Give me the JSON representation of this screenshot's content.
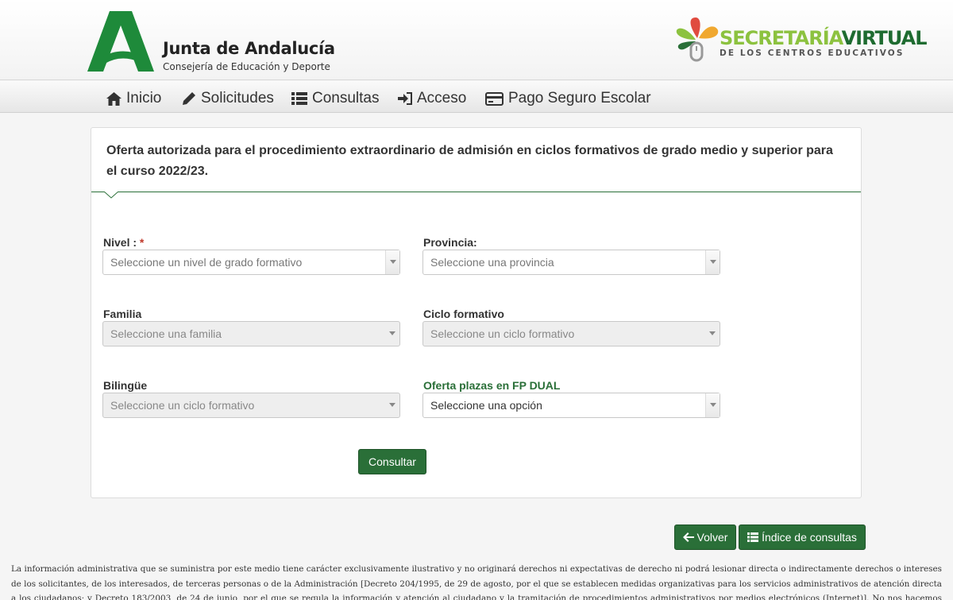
{
  "header": {
    "org_name": "Junta de Andalucía",
    "org_sub": "Consejería de Educación y Deporte",
    "sv_title_a": "SECRETARÍA",
    "sv_title_b": "VIRTUAL",
    "sv_sub": "DE LOS CENTROS EDUCATIVOS"
  },
  "nav": [
    {
      "label": "Inicio",
      "icon": "home-icon"
    },
    {
      "label": "Solicitudes",
      "icon": "pencil-icon"
    },
    {
      "label": "Consultas",
      "icon": "list-icon"
    },
    {
      "label": "Acceso",
      "icon": "sign-in-icon"
    },
    {
      "label": "Pago Seguro Escolar",
      "icon": "credit-card-icon"
    }
  ],
  "panel": {
    "title": "Oferta autorizada para el procedimiento extraordinario de admisión en ciclos formativos de grado medio y superior para el curso 2022/23."
  },
  "form": {
    "nivel": {
      "label": "Nivel :",
      "required_mark": "*",
      "placeholder": "Seleccione un nivel de grado formativo"
    },
    "provincia": {
      "label": "Provincia:",
      "placeholder": "Seleccione una provincia"
    },
    "familia": {
      "label": "Familia",
      "placeholder": "Seleccione una familia"
    },
    "ciclo": {
      "label": "Ciclo formativo",
      "placeholder": "Seleccione un ciclo formativo"
    },
    "bilingue": {
      "label": "Bilingüe",
      "placeholder": "Seleccione un ciclo formativo"
    },
    "dual": {
      "label": "Oferta plazas en FP DUAL",
      "value": "Seleccione una opción"
    },
    "submit_label": "Consultar"
  },
  "footer_buttons": {
    "back_label": "Volver",
    "index_label": "Índice de consultas"
  },
  "legal_text": "La información administrativa que se suministra por este medio tiene carácter exclusivamente ilustrativo y no originará derechos ni expectativas de derecho ni podrá lesionar directa o indirectamente derechos o intereses de los solicitantes, de los interesados, de terceras personas o de la Administración [Decreto 204/1995, de 29 de agosto, por el que se establecen medidas organizativas para los servicios administrativos de atención directa a los ciudadanos; y Decreto 183/2003, de 24 de junio, por el que se regula la información y atención al ciudadano y la tramitación de procedimientos administrativos por medios electrónicos (Internet)]. No nos hacemos responsables",
  "colors": {
    "primary_green": "#2a6f38",
    "light_green": "#8cc23f"
  }
}
